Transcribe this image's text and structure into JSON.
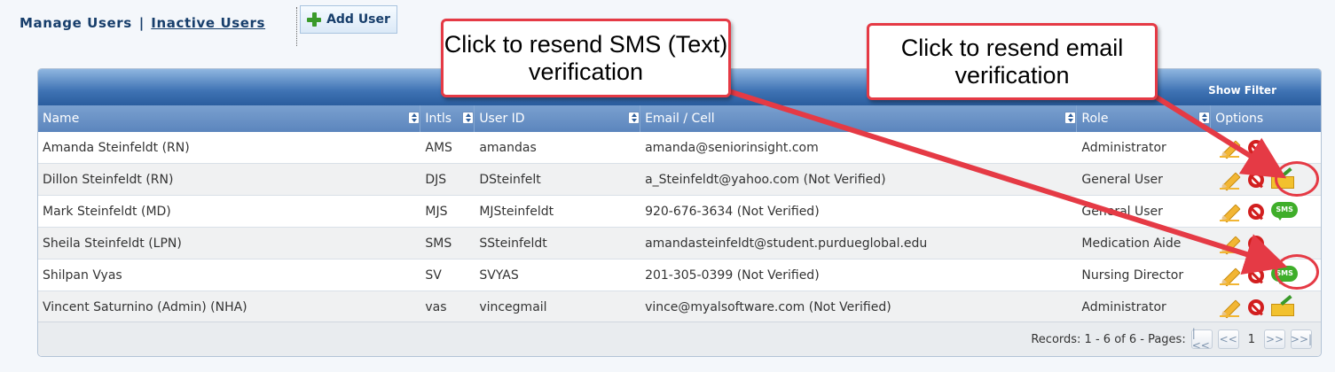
{
  "nav": {
    "manage_users": "Manage Users",
    "separator": "|",
    "inactive_users": "Inactive Users",
    "add_user": "Add User"
  },
  "grid": {
    "show_filter": "Show Filter",
    "columns": [
      "Name",
      "Intls",
      "User ID",
      "Email / Cell",
      "Role",
      "Options"
    ],
    "rows": [
      {
        "name": "Amanda Steinfeldt (RN)",
        "intls": "AMS",
        "user_id": "amandas",
        "contact": "amanda@seniorinsight.com",
        "role": "Administrator",
        "resend": "none"
      },
      {
        "name": "Dillon Steinfeldt (RN)",
        "intls": "DJS",
        "user_id": "DSteinfelt",
        "contact": "a_Steinfeldt@yahoo.com (Not Verified)",
        "role": "General User",
        "resend": "email"
      },
      {
        "name": "Mark Steinfeldt (MD)",
        "intls": "MJS",
        "user_id": "MJSteinfeldt",
        "contact": "920-676-3634 (Not Verified)",
        "role": "General User",
        "resend": "sms"
      },
      {
        "name": "Sheila Steinfeldt (LPN)",
        "intls": "SMS",
        "user_id": "SSteinfeldt",
        "contact": "amandasteinfeldt@student.purdueglobal.edu",
        "role": "Medication Aide",
        "resend": "none"
      },
      {
        "name": "Shilpan Vyas",
        "intls": "SV",
        "user_id": "SVYAS",
        "contact": "201-305-0399 (Not Verified)",
        "role": "Nursing Director",
        "resend": "sms"
      },
      {
        "name": "Vincent Saturnino (Admin) (NHA)",
        "intls": "vas",
        "user_id": "vincegmail",
        "contact": "vince@myalsoftware.com (Not Verified)",
        "role": "Administrator",
        "resend": "email"
      }
    ],
    "sms_label": "SMS",
    "records_text": "Records: 1 - 6 of 6 - Pages:",
    "page": "1"
  },
  "callouts": {
    "sms": "Click to resend SMS (Text) verification",
    "email": "Click to resend email verification"
  },
  "colors": {
    "accent_red": "#e53a45",
    "header_blue": "#5b85bd",
    "sms_green": "#3fae2a"
  }
}
